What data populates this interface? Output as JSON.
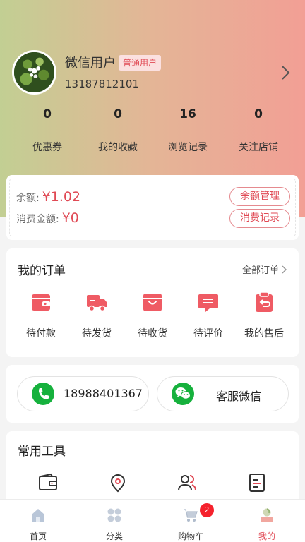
{
  "profile": {
    "name": "微信用户",
    "badge": "普通用户",
    "phone": "13187812101"
  },
  "stats": [
    {
      "value": "0",
      "label": "优惠券"
    },
    {
      "value": "0",
      "label": "我的收藏"
    },
    {
      "value": "16",
      "label": "浏览记录"
    },
    {
      "value": "0",
      "label": "关注店铺"
    }
  ],
  "balance": {
    "balance_label": "余额:",
    "balance_value": "¥1.02",
    "spent_label": "消费金额:",
    "spent_value": "¥0",
    "manage_button": "余额管理",
    "records_button": "消费记录"
  },
  "orders": {
    "title": "我的订单",
    "see_all": "全部订单",
    "items": [
      {
        "label": "待付款",
        "icon": "wallet-icon"
      },
      {
        "label": "待发货",
        "icon": "truck-icon"
      },
      {
        "label": "待收货",
        "icon": "package-icon"
      },
      {
        "label": "待评价",
        "icon": "comment-icon"
      },
      {
        "label": "我的售后",
        "icon": "return-icon"
      }
    ]
  },
  "contact": {
    "phone": "18988401367",
    "wechat": "客服微信"
  },
  "tools": {
    "title": "常用工具",
    "icons": [
      "wallet-outline-icon",
      "location-pin-icon",
      "users-icon",
      "ledger-icon"
    ]
  },
  "tabbar": {
    "items": [
      {
        "label": "首页",
        "icon": "home-icon"
      },
      {
        "label": "分类",
        "icon": "category-icon"
      },
      {
        "label": "购物车",
        "icon": "cart-icon"
      },
      {
        "label": "我的",
        "icon": "profile-icon"
      }
    ],
    "cart_badge": "2",
    "active_index": 3
  },
  "colors": {
    "accent": "#e04a55",
    "wechat_green": "#16b13d"
  }
}
